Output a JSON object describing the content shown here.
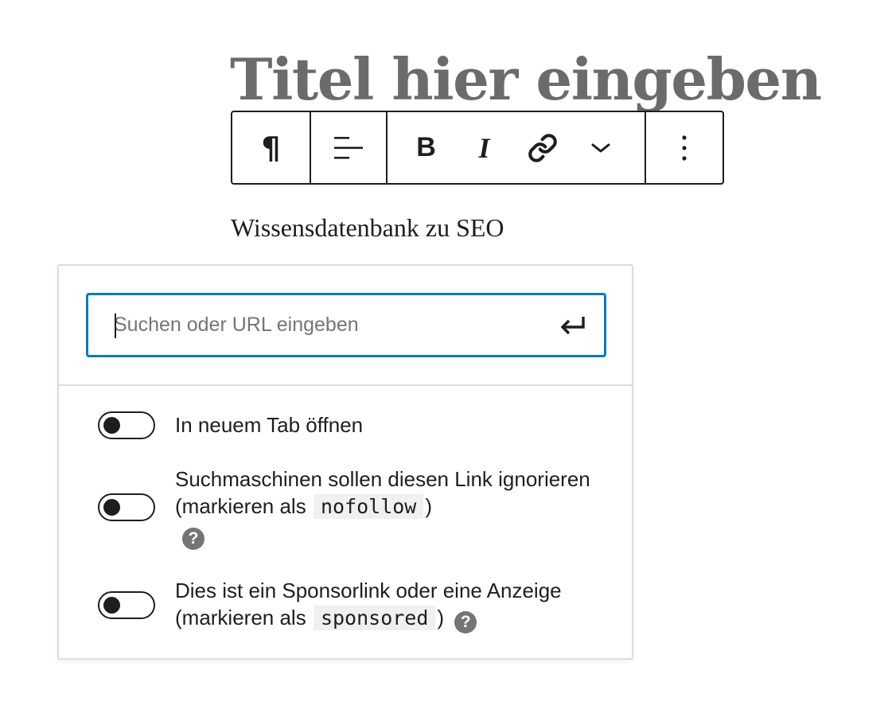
{
  "editor": {
    "title": "Titel hier eingeben",
    "paragraph": "Wissensdatenbank zu SEO"
  },
  "toolbar": {
    "paragraph_glyph": "¶",
    "bold_glyph": "B",
    "italic_glyph": "I",
    "more_glyph": "⋮",
    "icons": [
      "paragraph-icon",
      "align-left-icon",
      "bold-icon",
      "italic-icon",
      "link-icon",
      "chevron-down-icon",
      "more-options-icon"
    ]
  },
  "link_popover": {
    "search_placeholder": "Suchen oder URL eingeben",
    "search_value": "",
    "submit_icon": "enter-return-icon",
    "accent_color": "#007cba",
    "options": [
      {
        "label": "In neuem Tab öffnen",
        "checked": false
      },
      {
        "label_before": "Suchmaschinen sollen diesen Link ignorieren (markieren als",
        "code": "nofollow",
        "label_after": ")",
        "help_glyph": "?",
        "checked": false
      },
      {
        "label_before": "Dies ist ein Sponsorlink oder eine Anzeige (markieren als",
        "code": "sponsored",
        "label_after": ")",
        "help_glyph": "?",
        "checked": false
      }
    ]
  }
}
